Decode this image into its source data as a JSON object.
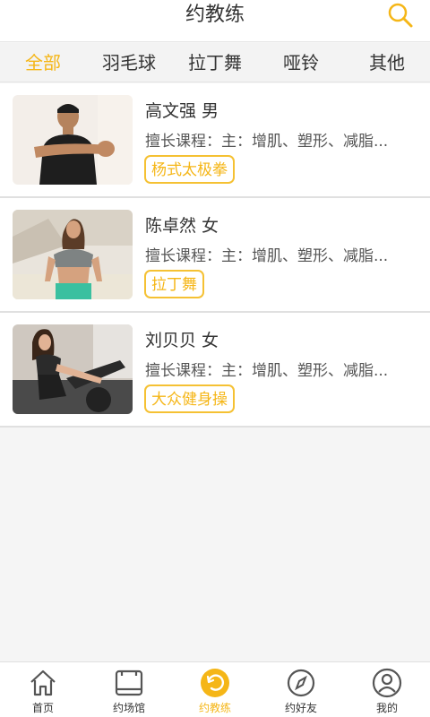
{
  "header": {
    "title": "约教练",
    "search_icon": "search-icon"
  },
  "tabs": [
    {
      "label": "全部",
      "active": true
    },
    {
      "label": "羽毛球",
      "active": false
    },
    {
      "label": "拉丁舞",
      "active": false
    },
    {
      "label": "哑铃",
      "active": false
    },
    {
      "label": "其他",
      "active": false
    }
  ],
  "coaches": [
    {
      "name": "高文强 男",
      "course": "擅长课程：主：增肌、塑形、减脂...",
      "tag": "杨式太极拳",
      "photo": "coach-photo-man-stretching"
    },
    {
      "name": "陈卓然 女",
      "course": "擅长课程：主：增肌、塑形、减脂...",
      "tag": "拉丁舞",
      "photo": "coach-photo-woman-sportswear"
    },
    {
      "name": "刘贝贝 女",
      "course": "擅长课程：主：增肌、塑形、减脂...",
      "tag": "大众健身操",
      "photo": "coach-photo-woman-gym-bike"
    }
  ],
  "bottom_nav": [
    {
      "label": "首页",
      "icon": "home-icon",
      "active": false
    },
    {
      "label": "约场馆",
      "icon": "venue-icon",
      "active": false
    },
    {
      "label": "约教练",
      "icon": "coach-icon",
      "active": true
    },
    {
      "label": "约好友",
      "icon": "compass-icon",
      "active": false
    },
    {
      "label": "我的",
      "icon": "profile-icon",
      "active": false
    }
  ],
  "colors": {
    "accent": "#f5b617",
    "text": "#333333",
    "background": "#f5f5f5"
  }
}
